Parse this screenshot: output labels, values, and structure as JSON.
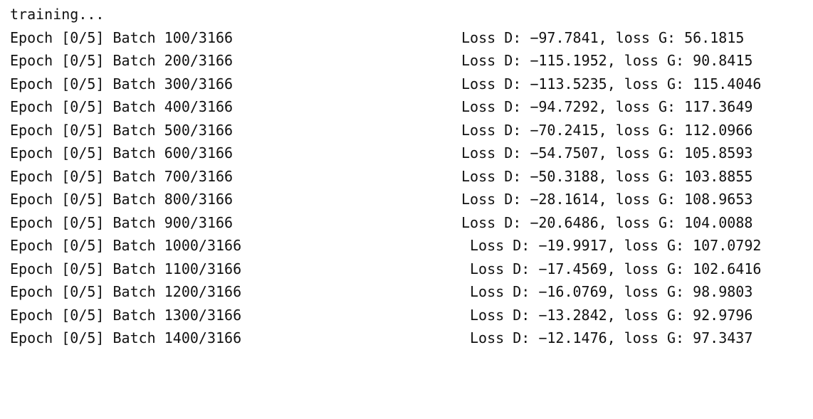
{
  "console": {
    "header": "training...",
    "lines": [
      {
        "progress": "Epoch [0/5] Batch 100/3166",
        "loss": "Loss D: −97.7841, loss G: 56.1815"
      },
      {
        "progress": "Epoch [0/5] Batch 200/3166",
        "loss": "Loss D: −115.1952, loss G: 90.8415"
      },
      {
        "progress": "Epoch [0/5] Batch 300/3166",
        "loss": "Loss D: −113.5235, loss G: 115.4046"
      },
      {
        "progress": "Epoch [0/5] Batch 400/3166",
        "loss": "Loss D: −94.7292, loss G: 117.3649"
      },
      {
        "progress": "Epoch [0/5] Batch 500/3166",
        "loss": "Loss D: −70.2415, loss G: 112.0966"
      },
      {
        "progress": "Epoch [0/5] Batch 600/3166",
        "loss": "Loss D: −54.7507, loss G: 105.8593"
      },
      {
        "progress": "Epoch [0/5] Batch 700/3166",
        "loss": "Loss D: −50.3188, loss G: 103.8855"
      },
      {
        "progress": "Epoch [0/5] Batch 800/3166",
        "loss": "Loss D: −28.1614, loss G: 108.9653"
      },
      {
        "progress": "Epoch [0/5] Batch 900/3166",
        "loss": "Loss D: −20.6486, loss G: 104.0088"
      },
      {
        "progress": "Epoch [0/5] Batch 1000/3166",
        "loss": "Loss D: −19.9917, loss G: 107.0792"
      },
      {
        "progress": "Epoch [0/5] Batch 1100/3166",
        "loss": "Loss D: −17.4569, loss G: 102.6416"
      },
      {
        "progress": "Epoch [0/5] Batch 1200/3166",
        "loss": "Loss D: −16.0769, loss G: 98.9803"
      },
      {
        "progress": "Epoch [0/5] Batch 1300/3166",
        "loss": "Loss D: −13.2842, loss G: 92.9796"
      },
      {
        "progress": "Epoch [0/5] Batch 1400/3166",
        "loss": "Loss D: −12.1476, loss G: 97.3437"
      }
    ]
  }
}
